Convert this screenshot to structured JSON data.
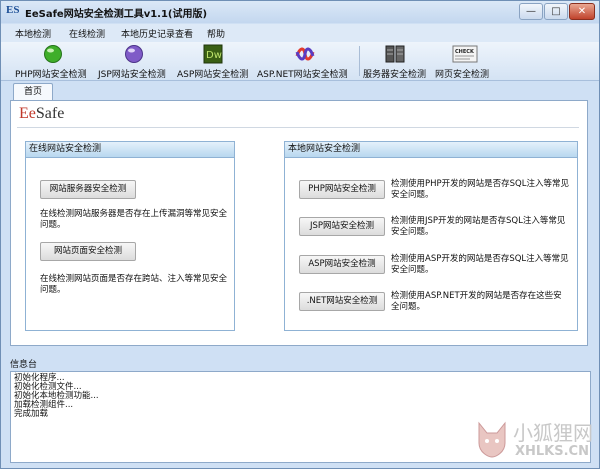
{
  "window": {
    "title": "EeSafe网站安全检测工具v1.1(试用版)",
    "icon_text": "ES",
    "min": "—",
    "max": "□",
    "close": "✕"
  },
  "menu": [
    "本地检测",
    "在线检测",
    "本地历史记录查看",
    "帮助"
  ],
  "toolbar": [
    {
      "label": "PHP网站安全检测",
      "icon": "php-icon"
    },
    {
      "label": "JSP网站安全检测",
      "icon": "jsp-icon"
    },
    {
      "label": "ASP网站安全检测",
      "icon": "dreamweaver-icon",
      "icon_text": "Dw"
    },
    {
      "label": "ASP.NET网站安全检测",
      "icon": "aspnet-icon"
    },
    {
      "label": "服务器安全检测",
      "icon": "server-icon"
    },
    {
      "label": "网页安全检测",
      "icon": "check-icon",
      "icon_text": "CHECK"
    }
  ],
  "tab": "首页",
  "logo": {
    "prefix": "Ee",
    "suffix": "Safe"
  },
  "online": {
    "title": "在线网站安全检测",
    "items": [
      {
        "button": "网站服务器安全检测",
        "desc": "在线检测网站服务器是否存在上传漏洞等常见安全问题。"
      },
      {
        "button": "网站页面安全检测",
        "desc": "在线检测网站页面是否存在跨站、注入等常见安全问题。"
      }
    ]
  },
  "local": {
    "title": "本地网站安全检测",
    "items": [
      {
        "button": "PHP网站安全检测",
        "desc": "检测使用PHP开发的网站是否存SQL注入等常见安全问题。"
      },
      {
        "button": "JSP网站安全检测",
        "desc": "检测使用JSP开发的网站是否存SQL注入等常见安全问题。"
      },
      {
        "button": "ASP网站安全检测",
        "desc": "检测使用ASP开发的网站是否存SQL注入等常见安全问题。"
      },
      {
        "button": ".NET网站安全检测",
        "desc": "检测使用ASP.NET开发的网站是否存在这些安全问题。"
      }
    ]
  },
  "info": {
    "title": "信息台",
    "lines": [
      "初始化程序...",
      "初始化检测文件...",
      "初始化本地检测功能...",
      "加载检测组件...",
      "完成加载"
    ]
  },
  "watermark": {
    "text": "小狐狸网",
    "sub": "XHLKS.CN"
  }
}
